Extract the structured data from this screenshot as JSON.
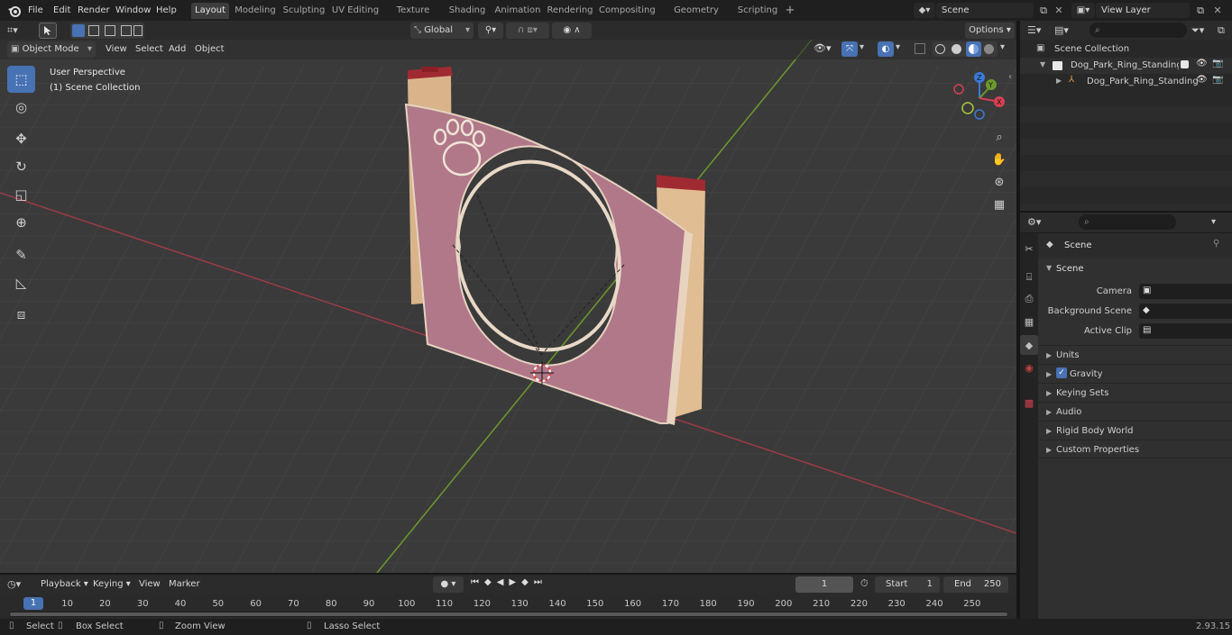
{
  "app": {
    "menu": [
      "File",
      "Edit",
      "Render",
      "Window",
      "Help"
    ],
    "workspaces": [
      "Layout",
      "Modeling",
      "Sculpting",
      "UV Editing",
      "Texture Paint",
      "Shading",
      "Animation",
      "Rendering",
      "Compositing",
      "Geometry Nodes",
      "Scripting"
    ],
    "active_workspace": "Layout",
    "scene_field": "Scene",
    "view_layer_field": "View Layer",
    "version": "2.93.15"
  },
  "viewport_header": {
    "mode": "Object Mode",
    "menus": [
      "View",
      "Select",
      "Add",
      "Object"
    ],
    "transform_orientation": "Global",
    "options_label": "Options"
  },
  "viewport": {
    "perspective_label": "User Perspective",
    "collection_label": "(1) Scene Collection",
    "gizmo_axes": [
      "X",
      "Y",
      "Z"
    ]
  },
  "toolbar": {
    "tools": [
      "select-box-icon",
      "cursor-icon",
      "move-icon",
      "rotate-icon",
      "scale-icon",
      "transform-icon",
      "annotate-icon",
      "measure-icon",
      "add-cube-icon"
    ]
  },
  "outliner": {
    "root": "Scene Collection",
    "items": [
      {
        "label": "Dog_Park_Ring_Standing_Rec",
        "level": 1
      },
      {
        "label": "Dog_Park_Ring_Standing",
        "level": 2
      }
    ]
  },
  "properties": {
    "context_name": "Scene",
    "section_title": "Scene",
    "fields": [
      {
        "label": "Camera"
      },
      {
        "label": "Background Scene"
      },
      {
        "label": "Active Clip"
      }
    ],
    "sections": [
      "Units",
      "Gravity",
      "Keying Sets",
      "Audio",
      "Rigid Body World",
      "Custom Properties"
    ],
    "gravity_checked": true
  },
  "timeline": {
    "menus": [
      "Playback",
      "Keying",
      "View",
      "Marker"
    ],
    "current_frame": "1",
    "start_label": "Start",
    "start_value": "1",
    "end_label": "End",
    "end_value": "250",
    "ruler": [
      "1",
      "10",
      "20",
      "30",
      "40",
      "50",
      "60",
      "70",
      "80",
      "90",
      "100",
      "110",
      "120",
      "130",
      "140",
      "150",
      "160",
      "170",
      "180",
      "190",
      "200",
      "210",
      "220",
      "230",
      "240",
      "250"
    ]
  },
  "statusbar": {
    "items": [
      "Select",
      "Box Select",
      "Zoom View",
      "Lasso Select"
    ]
  },
  "colors": {
    "accent": "#4772b3",
    "panel_pink": "#b07888",
    "post_wood": "#d9b48a",
    "cap_red": "#a02a32",
    "x_axis": "#9c3c46",
    "y_axis": "#6c9a2e"
  }
}
